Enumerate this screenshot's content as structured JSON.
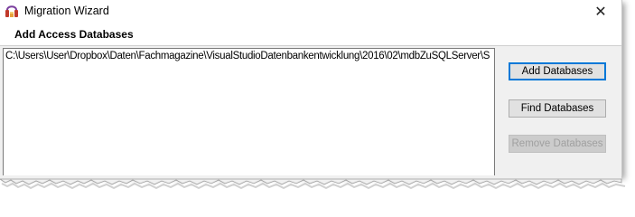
{
  "window": {
    "title": "Migration Wizard",
    "close_glyph": "✕"
  },
  "page": {
    "heading": "Add Access Databases"
  },
  "database_list": {
    "items": [
      "C:\\Users\\User\\Dropbox\\Daten\\Fachmagazine\\VisualStudioDatenbankentwicklung\\2016\\02\\mdbZuSQLServer\\S"
    ]
  },
  "buttons": {
    "add": "Add Databases",
    "find": "Find Databases",
    "remove": "Remove Databases"
  },
  "icons": {
    "app": "migration-wizard-icon",
    "close": "close-icon"
  },
  "colors": {
    "default_button_border": "#0078d7",
    "disabled_text": "#a0a0a0"
  }
}
